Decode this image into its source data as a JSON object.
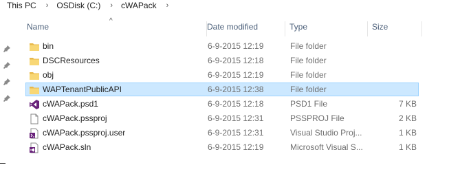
{
  "breadcrumb": {
    "items": [
      "This PC",
      "OSDisk (C:)",
      "cWAPack"
    ],
    "separator": "›"
  },
  "columns": {
    "name": "Name",
    "date": "Date modified",
    "type": "Type",
    "size": "Size"
  },
  "files": [
    {
      "name": "bin",
      "date": "6-9-2015 12:19",
      "type": "File folder",
      "size": "",
      "icon": "folder-icon"
    },
    {
      "name": "DSCResources",
      "date": "6-9-2015 12:18",
      "type": "File folder",
      "size": "",
      "icon": "folder-icon"
    },
    {
      "name": "obj",
      "date": "6-9-2015 12:19",
      "type": "File folder",
      "size": "",
      "icon": "folder-icon"
    },
    {
      "name": "WAPTenantPublicAPI",
      "date": "6-9-2015 12:38",
      "type": "File folder",
      "size": "",
      "icon": "folder-icon",
      "selected": true
    },
    {
      "name": "cWAPack.psd1",
      "date": "6-9-2015 12:18",
      "type": "PSD1 File",
      "size": "7 KB",
      "icon": "visual-studio-icon"
    },
    {
      "name": "cWAPack.pssproj",
      "date": "6-9-2015 12:31",
      "type": "PSSPROJ File",
      "size": "2 KB",
      "icon": "blank-file-icon"
    },
    {
      "name": "cWAPack.pssproj.user",
      "date": "6-9-2015 12:31",
      "type": "Visual Studio Proj...",
      "size": "1 KB",
      "icon": "vs-project-icon"
    },
    {
      "name": "cWAPack.sln",
      "date": "6-9-2015 12:19",
      "type": "Microsoft Visual S...",
      "size": "1 KB",
      "icon": "vs-solution-icon"
    }
  ],
  "colors": {
    "folder": "#f8d775",
    "selection": "#cce8ff",
    "selection_border": "#99d1ff",
    "visual_studio": "#68217a"
  }
}
